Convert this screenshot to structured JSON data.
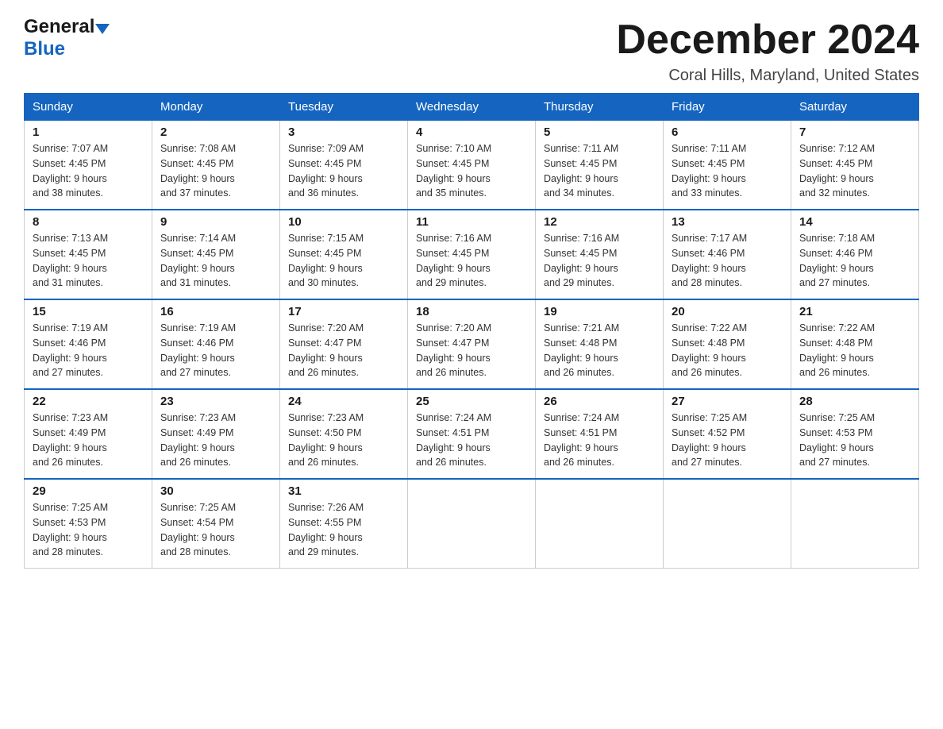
{
  "header": {
    "logo_general": "General",
    "logo_blue": "Blue",
    "title": "December 2024",
    "location": "Coral Hills, Maryland, United States"
  },
  "calendar": {
    "days_of_week": [
      "Sunday",
      "Monday",
      "Tuesday",
      "Wednesday",
      "Thursday",
      "Friday",
      "Saturday"
    ],
    "weeks": [
      [
        {
          "day": "1",
          "sunrise": "7:07 AM",
          "sunset": "4:45 PM",
          "daylight": "9 hours and 38 minutes."
        },
        {
          "day": "2",
          "sunrise": "7:08 AM",
          "sunset": "4:45 PM",
          "daylight": "9 hours and 37 minutes."
        },
        {
          "day": "3",
          "sunrise": "7:09 AM",
          "sunset": "4:45 PM",
          "daylight": "9 hours and 36 minutes."
        },
        {
          "day": "4",
          "sunrise": "7:10 AM",
          "sunset": "4:45 PM",
          "daylight": "9 hours and 35 minutes."
        },
        {
          "day": "5",
          "sunrise": "7:11 AM",
          "sunset": "4:45 PM",
          "daylight": "9 hours and 34 minutes."
        },
        {
          "day": "6",
          "sunrise": "7:11 AM",
          "sunset": "4:45 PM",
          "daylight": "9 hours and 33 minutes."
        },
        {
          "day": "7",
          "sunrise": "7:12 AM",
          "sunset": "4:45 PM",
          "daylight": "9 hours and 32 minutes."
        }
      ],
      [
        {
          "day": "8",
          "sunrise": "7:13 AM",
          "sunset": "4:45 PM",
          "daylight": "9 hours and 31 minutes."
        },
        {
          "day": "9",
          "sunrise": "7:14 AM",
          "sunset": "4:45 PM",
          "daylight": "9 hours and 31 minutes."
        },
        {
          "day": "10",
          "sunrise": "7:15 AM",
          "sunset": "4:45 PM",
          "daylight": "9 hours and 30 minutes."
        },
        {
          "day": "11",
          "sunrise": "7:16 AM",
          "sunset": "4:45 PM",
          "daylight": "9 hours and 29 minutes."
        },
        {
          "day": "12",
          "sunrise": "7:16 AM",
          "sunset": "4:45 PM",
          "daylight": "9 hours and 29 minutes."
        },
        {
          "day": "13",
          "sunrise": "7:17 AM",
          "sunset": "4:46 PM",
          "daylight": "9 hours and 28 minutes."
        },
        {
          "day": "14",
          "sunrise": "7:18 AM",
          "sunset": "4:46 PM",
          "daylight": "9 hours and 27 minutes."
        }
      ],
      [
        {
          "day": "15",
          "sunrise": "7:19 AM",
          "sunset": "4:46 PM",
          "daylight": "9 hours and 27 minutes."
        },
        {
          "day": "16",
          "sunrise": "7:19 AM",
          "sunset": "4:46 PM",
          "daylight": "9 hours and 27 minutes."
        },
        {
          "day": "17",
          "sunrise": "7:20 AM",
          "sunset": "4:47 PM",
          "daylight": "9 hours and 26 minutes."
        },
        {
          "day": "18",
          "sunrise": "7:20 AM",
          "sunset": "4:47 PM",
          "daylight": "9 hours and 26 minutes."
        },
        {
          "day": "19",
          "sunrise": "7:21 AM",
          "sunset": "4:48 PM",
          "daylight": "9 hours and 26 minutes."
        },
        {
          "day": "20",
          "sunrise": "7:22 AM",
          "sunset": "4:48 PM",
          "daylight": "9 hours and 26 minutes."
        },
        {
          "day": "21",
          "sunrise": "7:22 AM",
          "sunset": "4:48 PM",
          "daylight": "9 hours and 26 minutes."
        }
      ],
      [
        {
          "day": "22",
          "sunrise": "7:23 AM",
          "sunset": "4:49 PM",
          "daylight": "9 hours and 26 minutes."
        },
        {
          "day": "23",
          "sunrise": "7:23 AM",
          "sunset": "4:49 PM",
          "daylight": "9 hours and 26 minutes."
        },
        {
          "day": "24",
          "sunrise": "7:23 AM",
          "sunset": "4:50 PM",
          "daylight": "9 hours and 26 minutes."
        },
        {
          "day": "25",
          "sunrise": "7:24 AM",
          "sunset": "4:51 PM",
          "daylight": "9 hours and 26 minutes."
        },
        {
          "day": "26",
          "sunrise": "7:24 AM",
          "sunset": "4:51 PM",
          "daylight": "9 hours and 26 minutes."
        },
        {
          "day": "27",
          "sunrise": "7:25 AM",
          "sunset": "4:52 PM",
          "daylight": "9 hours and 27 minutes."
        },
        {
          "day": "28",
          "sunrise": "7:25 AM",
          "sunset": "4:53 PM",
          "daylight": "9 hours and 27 minutes."
        }
      ],
      [
        {
          "day": "29",
          "sunrise": "7:25 AM",
          "sunset": "4:53 PM",
          "daylight": "9 hours and 28 minutes."
        },
        {
          "day": "30",
          "sunrise": "7:25 AM",
          "sunset": "4:54 PM",
          "daylight": "9 hours and 28 minutes."
        },
        {
          "day": "31",
          "sunrise": "7:26 AM",
          "sunset": "4:55 PM",
          "daylight": "9 hours and 29 minutes."
        },
        null,
        null,
        null,
        null
      ]
    ]
  }
}
